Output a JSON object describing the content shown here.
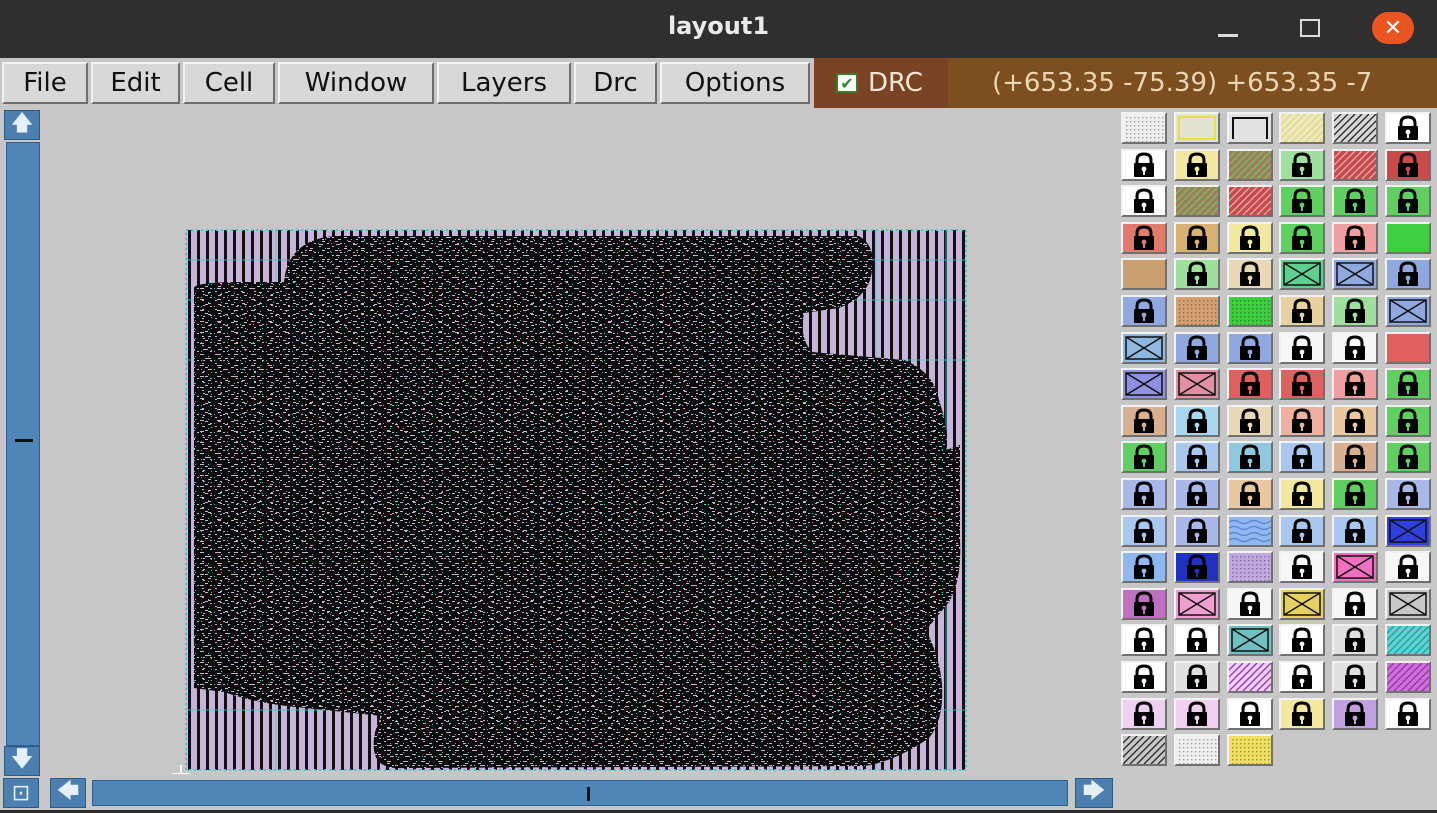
{
  "window": {
    "title": "layout1"
  },
  "menubar": {
    "items": [
      "File",
      "Edit",
      "Cell",
      "Window",
      "Layers",
      "Drc",
      "Options"
    ],
    "drc_label": "DRC",
    "drc_checked": true,
    "coords": "(+653.35 -75.39) +653.35 -7"
  },
  "layers": {
    "rows": [
      [
        {
          "b": "#efefef",
          "p": "dots"
        },
        {
          "b": "#e2e2d0",
          "p": "outline-yellow"
        },
        {
          "b": "#e2e2e2",
          "p": "outline-black"
        },
        {
          "b": "#e6e0a0",
          "p": "hatch-light"
        },
        {
          "b": "#d7d7d7",
          "p": "hatch-dark"
        },
        {
          "b": "#ffffff",
          "p": "lock"
        }
      ],
      [
        {
          "b": "#ffffff",
          "p": "lock"
        },
        {
          "b": "#f2e8a0",
          "p": "lock"
        },
        {
          "b": "#a67b5b",
          "p": "hatch-green"
        },
        {
          "b": "#9fe09f",
          "p": "lock"
        },
        {
          "b": "#c84a4a",
          "p": "hatch-light"
        },
        {
          "b": "#c84a4a",
          "p": "lock"
        }
      ],
      [
        {
          "b": "#ffffff",
          "p": "lock"
        },
        {
          "b": "#a67b5b",
          "p": "hatch-green"
        },
        {
          "b": "#c84a4a",
          "p": "hatch-light"
        },
        {
          "b": "#5fcf5f",
          "p": "lock"
        },
        {
          "b": "#5fcf5f",
          "p": "lock"
        },
        {
          "b": "#5fcf5f",
          "p": "lock"
        }
      ],
      [
        {
          "b": "#e07a6a",
          "p": "lock"
        },
        {
          "b": "#d8b070",
          "p": "lock"
        },
        {
          "b": "#f2e8a0",
          "p": "lock"
        },
        {
          "b": "#5fcf5f",
          "p": "lock"
        },
        {
          "b": "#f0a0a0",
          "p": "lock"
        },
        {
          "b": "#3ecf3e",
          "p": "solid"
        }
      ],
      [
        {
          "b": "#c9a070",
          "p": "solid"
        },
        {
          "b": "#9fe09f",
          "p": "lock"
        },
        {
          "b": "#e9d8b8",
          "p": "lock"
        },
        {
          "b": "#5fcf8f",
          "p": "cross"
        },
        {
          "b": "#8fa8e0",
          "p": "cross"
        },
        {
          "b": "#8fa8e0",
          "p": "lock"
        }
      ],
      [
        {
          "b": "#8fa8e0",
          "p": "lock"
        },
        {
          "b": "#d4a070",
          "p": "dots"
        },
        {
          "b": "#3ecf3e",
          "p": "dots"
        },
        {
          "b": "#e9d0a0",
          "p": "lock"
        },
        {
          "b": "#9fe09f",
          "p": "lock"
        },
        {
          "b": "#8fa8e0",
          "p": "cross"
        }
      ],
      [
        {
          "b": "#8fb8e0",
          "p": "cross"
        },
        {
          "b": "#8fa8e0",
          "p": "lock"
        },
        {
          "b": "#8fa8e0",
          "p": "lock"
        },
        {
          "b": "#f7f7f7",
          "p": "lock"
        },
        {
          "b": "#f7f7f7",
          "p": "lock"
        },
        {
          "b": "#e06060",
          "p": "solid"
        }
      ],
      [
        {
          "b": "#9090e0",
          "p": "cross"
        },
        {
          "b": "#e090a0",
          "p": "cross"
        },
        {
          "b": "#e06060",
          "p": "lock"
        },
        {
          "b": "#e06060",
          "p": "lock"
        },
        {
          "b": "#f0a0a0",
          "p": "lock"
        },
        {
          "b": "#5fcf5f",
          "p": "lock"
        }
      ],
      [
        {
          "b": "#d8b090",
          "p": "lock"
        },
        {
          "b": "#a8d8f0",
          "p": "lock"
        },
        {
          "b": "#e9d8b8",
          "p": "lock"
        },
        {
          "b": "#f0b0a0",
          "p": "lock"
        },
        {
          "b": "#e9c8a0",
          "p": "lock"
        },
        {
          "b": "#5fcf5f",
          "p": "lock"
        }
      ],
      [
        {
          "b": "#5fcf5f",
          "p": "lock"
        },
        {
          "b": "#a8c8f0",
          "p": "lock"
        },
        {
          "b": "#90c8e0",
          "p": "lock"
        },
        {
          "b": "#a8c8f0",
          "p": "lock"
        },
        {
          "b": "#d8b090",
          "p": "lock"
        },
        {
          "b": "#5fcf5f",
          "p": "lock"
        }
      ],
      [
        {
          "b": "#a8b8e8",
          "p": "lock"
        },
        {
          "b": "#a8b8e8",
          "p": "lock"
        },
        {
          "b": "#e9c8a0",
          "p": "lock"
        },
        {
          "b": "#f2e8a0",
          "p": "lock"
        },
        {
          "b": "#5fcf5f",
          "p": "lock"
        },
        {
          "b": "#a8b8e8",
          "p": "lock"
        }
      ],
      [
        {
          "b": "#a8c8f0",
          "p": "lock"
        },
        {
          "b": "#a8b8e8",
          "p": "lock"
        },
        {
          "b": "#8fb8f0",
          "p": "wave"
        },
        {
          "b": "#a8c8f0",
          "p": "lock"
        },
        {
          "b": "#a8c8f0",
          "p": "lock"
        },
        {
          "b": "#3040e0",
          "p": "cross"
        }
      ],
      [
        {
          "b": "#8fb8f0",
          "p": "lock"
        },
        {
          "b": "#2030c0",
          "p": "lock"
        },
        {
          "b": "#c0a8e0",
          "p": "dots"
        },
        {
          "b": "#f7f7f7",
          "p": "lock"
        },
        {
          "b": "#f070c0",
          "p": "cross"
        },
        {
          "b": "#f7f7f7",
          "p": "lock"
        }
      ],
      [
        {
          "b": "#c070c0",
          "p": "lock"
        },
        {
          "b": "#f0a0d0",
          "p": "cross"
        },
        {
          "b": "#f7f7f7",
          "p": "lock"
        },
        {
          "b": "#e8d060",
          "p": "cross"
        },
        {
          "b": "#f7f7f7",
          "p": "lock"
        },
        {
          "b": "#c8c8c8",
          "p": "cross"
        }
      ],
      [
        {
          "b": "#ffffff",
          "p": "lock"
        },
        {
          "b": "#ffffff",
          "p": "lock"
        },
        {
          "b": "#70c0c0",
          "p": "cross"
        },
        {
          "b": "#ffffff",
          "p": "lock"
        },
        {
          "b": "#e0e0e0",
          "p": "lock"
        },
        {
          "b": "#60d0d0",
          "p": "hatch-teal"
        }
      ],
      [
        {
          "b": "#ffffff",
          "p": "lock"
        },
        {
          "b": "#e0e0e0",
          "p": "lock"
        },
        {
          "b": "#f0d0f0",
          "p": "hatch-purple"
        },
        {
          "b": "#ffffff",
          "p": "lock"
        },
        {
          "b": "#e0e0e0",
          "p": "lock"
        },
        {
          "b": "#d070d0",
          "p": "hatch-purple"
        }
      ],
      [
        {
          "b": "#f0d0f0",
          "p": "lock"
        },
        {
          "b": "#f0d0f0",
          "p": "lock"
        },
        {
          "b": "#ffffff",
          "p": "lock"
        },
        {
          "b": "#f2e8a0",
          "p": "lock"
        },
        {
          "b": "#c0a0e0",
          "p": "lock"
        },
        {
          "b": "#ffffff",
          "p": "lock"
        }
      ],
      [
        {
          "b": "#c7c7c7",
          "p": "hatch-dark"
        },
        {
          "b": "#f0f0f0",
          "p": "dots"
        },
        {
          "b": "#f0e060",
          "p": "dots"
        }
      ]
    ]
  }
}
